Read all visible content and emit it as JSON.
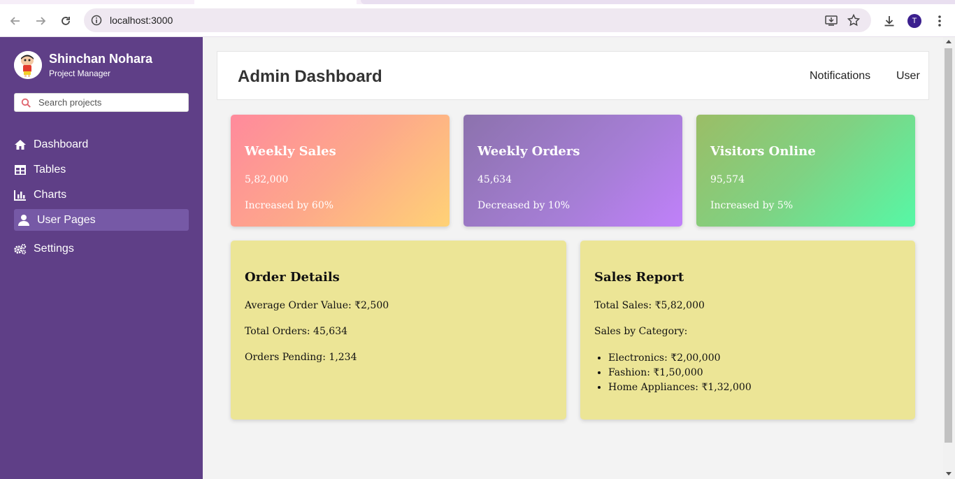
{
  "browser": {
    "url": "localhost:3000",
    "profile_initial": "T"
  },
  "sidebar": {
    "user_name": "Shinchan Nohara",
    "user_role": "Project Manager",
    "search_placeholder": "Search projects",
    "items": [
      {
        "label": "Dashboard",
        "icon": "home-icon"
      },
      {
        "label": "Tables",
        "icon": "table-icon"
      },
      {
        "label": "Charts",
        "icon": "bar-chart-icon"
      },
      {
        "label": "User Pages",
        "icon": "user-icon",
        "active": true
      },
      {
        "label": "Settings",
        "icon": "gears-icon"
      }
    ],
    "bg_color": "#5f3f87"
  },
  "header": {
    "title": "Admin Dashboard",
    "notifications_label": "Notifications",
    "user_label": "User"
  },
  "cards": [
    {
      "title": "Weekly Sales",
      "value": "5,82,000",
      "note": "Increased by 60%"
    },
    {
      "title": "Weekly Orders",
      "value": "45,634",
      "note": "Decreased by 10%"
    },
    {
      "title": "Visitors Online",
      "value": "95,574",
      "note": "Increased by 5%"
    }
  ],
  "order_details": {
    "title": "Order Details",
    "lines": [
      "Average Order Value: ₹2,500",
      "Total Orders: 45,634",
      "Orders Pending: 1,234"
    ]
  },
  "sales_report": {
    "title": "Sales Report",
    "total": "Total Sales: ₹5,82,000",
    "by_category_label": "Sales by Category:",
    "categories": [
      "Electronics: ₹2,00,000",
      "Fashion: ₹1,50,000",
      "Home Appliances: ₹1,32,000"
    ]
  },
  "panel_color": "#ece596"
}
